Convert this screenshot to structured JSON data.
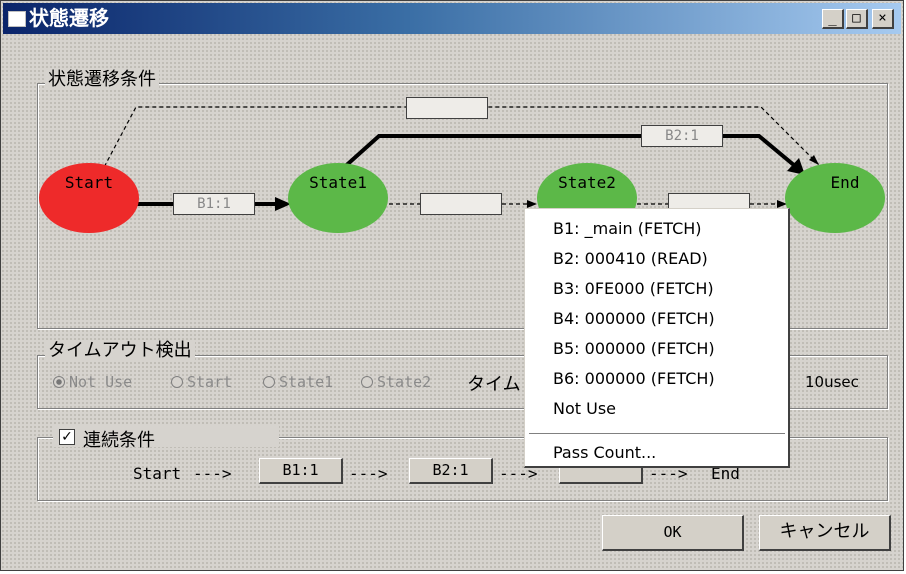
{
  "window": {
    "title": "状態遷移",
    "controls": {
      "minimize": "_",
      "maximize": "□",
      "close": "×"
    }
  },
  "transition_group": {
    "label": "状態遷移条件",
    "states": {
      "start": {
        "label": "Start",
        "color": "#ee2a2a"
      },
      "state1": {
        "label": "State1",
        "color": "#5cb848"
      },
      "state2": {
        "label": "State2",
        "color": "#5cb848"
      },
      "end": {
        "label": "End",
        "color": "#5cb848"
      }
    },
    "conditions": {
      "start_state1": "B1:1",
      "state1_end": "B2:1",
      "start_end": "",
      "state1_state2": "",
      "state2_end": ""
    }
  },
  "timeout_group": {
    "label": "タイムアウト検出",
    "options": [
      "Not Use",
      "Start",
      "State1",
      "State2"
    ],
    "selected": "Not Use",
    "time_label": "タイム",
    "time_value": "10usec"
  },
  "sequence_group": {
    "checkbox_label": "連続条件",
    "checked": true,
    "start": "Start",
    "arrow": "--->",
    "buttons": [
      "B1:1",
      "B2:1",
      ""
    ],
    "end": "End"
  },
  "footer": {
    "ok": "OK",
    "cancel": "キャンセル"
  },
  "context_menu": {
    "items": [
      "B1: _main (FETCH)",
      "B2: 000410 (READ)",
      "B3: 0FE000 (FETCH)",
      "B4: 000000 (FETCH)",
      "B5: 000000 (FETCH)",
      "B6: 000000 (FETCH)",
      "Not Use"
    ],
    "pass_count": "Pass Count..."
  }
}
